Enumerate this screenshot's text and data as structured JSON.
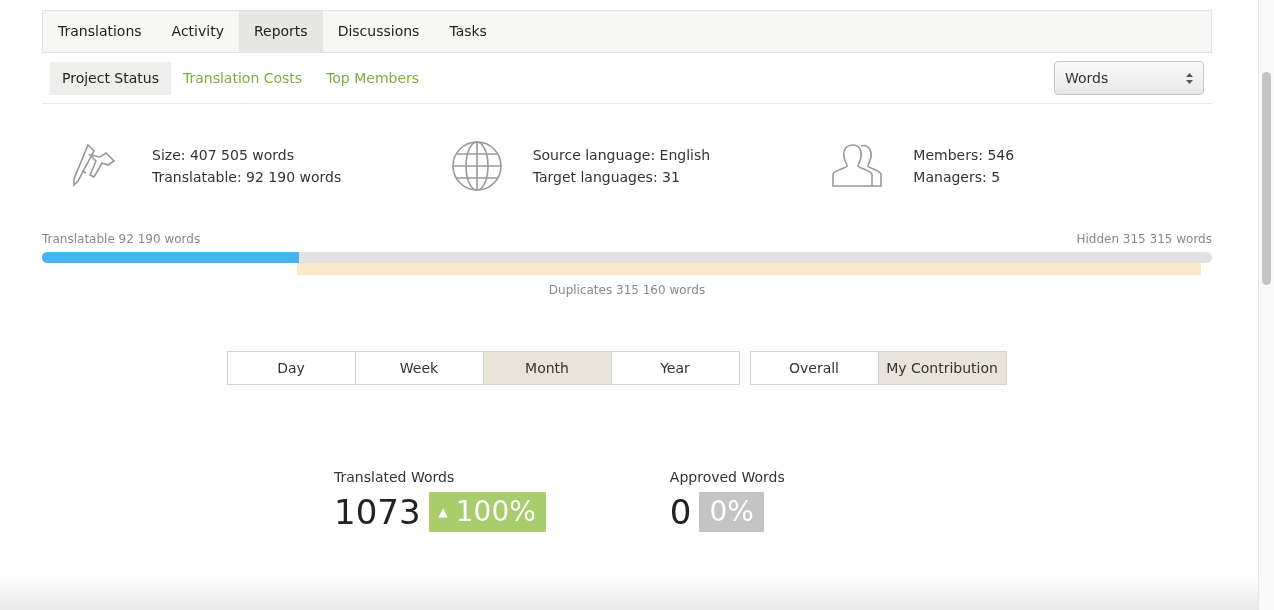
{
  "tabs": [
    {
      "label": "Translations",
      "selected": false
    },
    {
      "label": "Activity",
      "selected": false
    },
    {
      "label": "Reports",
      "selected": true
    },
    {
      "label": "Discussions",
      "selected": false
    },
    {
      "label": "Tasks",
      "selected": false
    }
  ],
  "subtabs": [
    {
      "label": "Project Status",
      "selected": true
    },
    {
      "label": "Translation Costs",
      "selected": false
    },
    {
      "label": "Top Members",
      "selected": false
    }
  ],
  "unit_select": {
    "value": "Words"
  },
  "summary": [
    {
      "kind": "caliper",
      "lines": [
        "Size: 407 505 words",
        "Translatable: 92 190 words"
      ]
    },
    {
      "kind": "globe",
      "lines": [
        "Source language: English",
        "Target languages: 31"
      ]
    },
    {
      "kind": "people",
      "lines": [
        "Members: 546",
        "Managers: 5"
      ]
    }
  ],
  "progress": {
    "left_label": "Translatable 92 190 words",
    "right_label": "Hidden 315 315 words",
    "level": 0.22,
    "duplicates": {
      "label": "Duplicates 315 160 words"
    }
  },
  "period_buttons": [
    {
      "label": "Day",
      "selected": false
    },
    {
      "label": "Week",
      "selected": false
    },
    {
      "label": "Month",
      "selected": true
    },
    {
      "label": "Year",
      "selected": false
    }
  ],
  "scope_buttons": [
    {
      "label": "Overall",
      "selected": false
    },
    {
      "label": "My Contribution",
      "selected": true
    }
  ],
  "metrics": [
    {
      "title": "Translated Words",
      "value": "1073",
      "kind": "up",
      "arrow": "▲",
      "change": "100%"
    },
    {
      "title": "Approved Words",
      "value": "0",
      "kind": "none",
      "change": "0%"
    }
  ]
}
